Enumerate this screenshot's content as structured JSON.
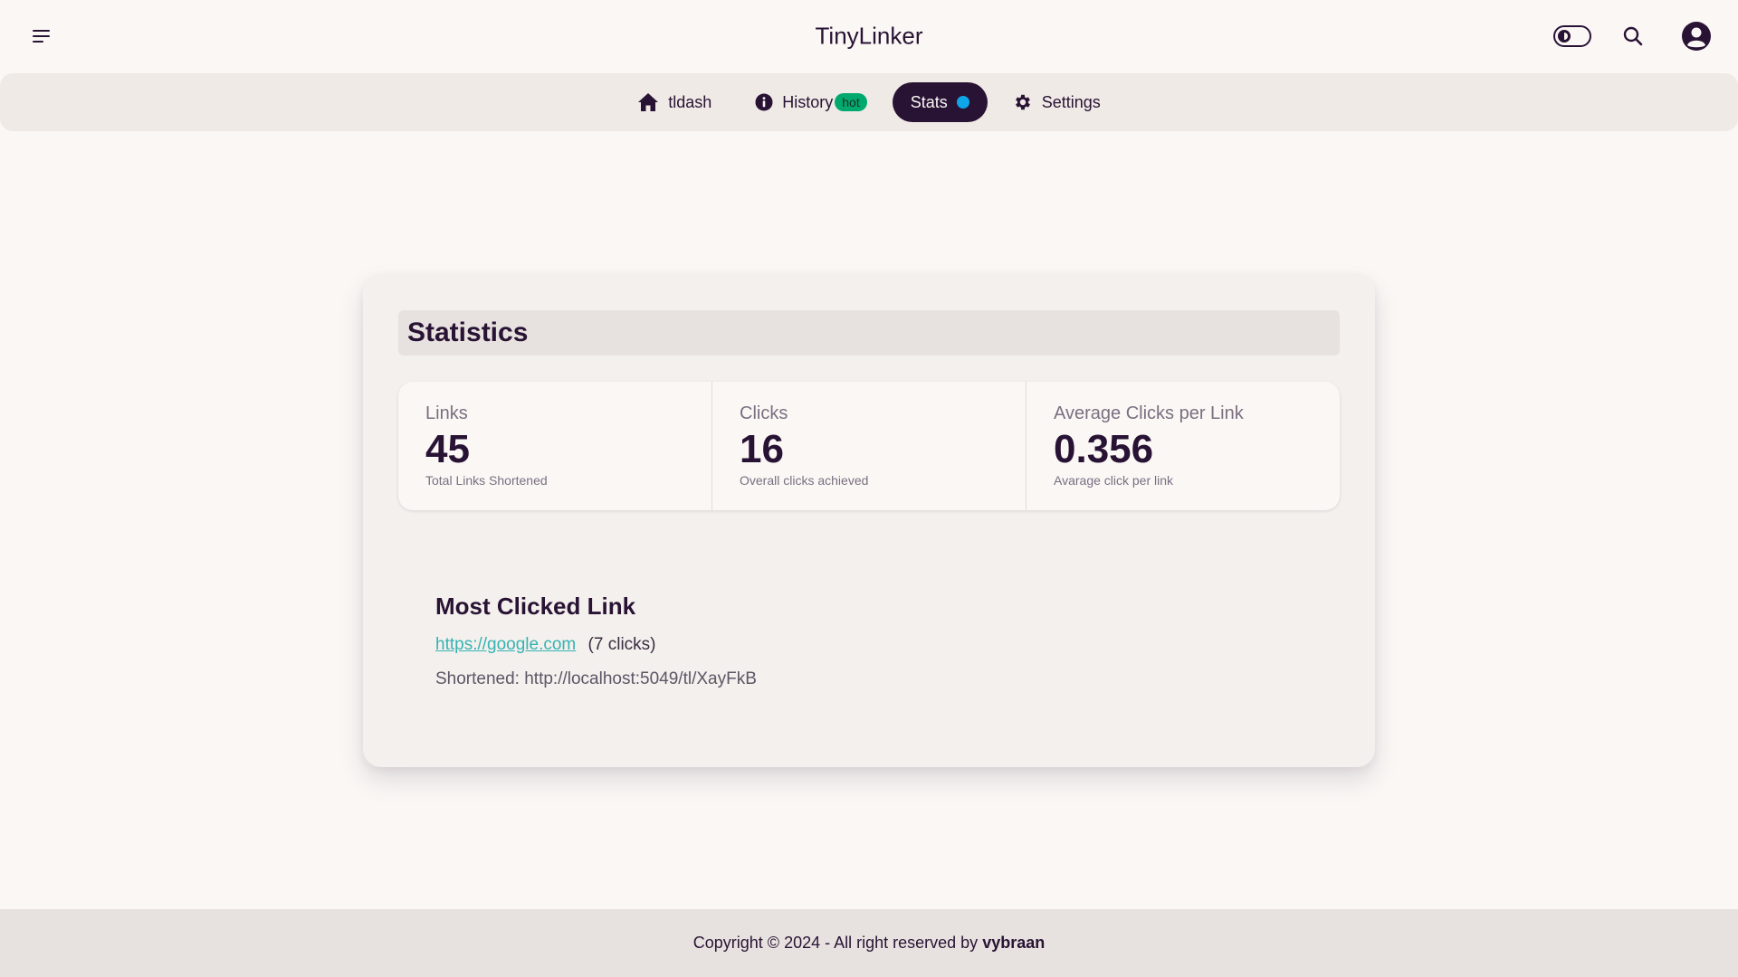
{
  "app": {
    "title": "TinyLinker"
  },
  "navbar": {
    "menu_icon": "hamburger-menu-icon",
    "theme_toggle_icon": "theme-toggle-icon",
    "search_icon": "search-icon",
    "profile_icon": "user-circle-icon"
  },
  "tabs": [
    {
      "label": "tldash",
      "icon": "home-icon"
    },
    {
      "label": "History",
      "icon": "info-icon",
      "badge": "hot"
    },
    {
      "label": "Stats",
      "active": true,
      "indicator_color": "#0ea5e9"
    },
    {
      "label": "Settings",
      "icon": "gear-icon"
    }
  ],
  "statistics": {
    "title": "Statistics",
    "items": [
      {
        "title": "Links",
        "value": "45",
        "desc": "Total Links Shortened"
      },
      {
        "title": "Clicks",
        "value": "16",
        "desc": "Overall clicks achieved"
      },
      {
        "title": "Average Clicks per Link",
        "value": "0.356",
        "desc": "Avarage click per link"
      }
    ]
  },
  "most_clicked": {
    "title": "Most Clicked Link",
    "url": "https://google.com",
    "clicks": "(7 clicks)",
    "shortened": "Shortened: http://localhost:5049/tl/XayFkB"
  },
  "footer": {
    "text": "Copyright © 2024 - All right reserved by",
    "author": "vybraan"
  },
  "colors": {
    "primary": "#291334",
    "accent_badge": "#00a96e",
    "link": "#37b3b3",
    "background": "#faf7f5"
  }
}
